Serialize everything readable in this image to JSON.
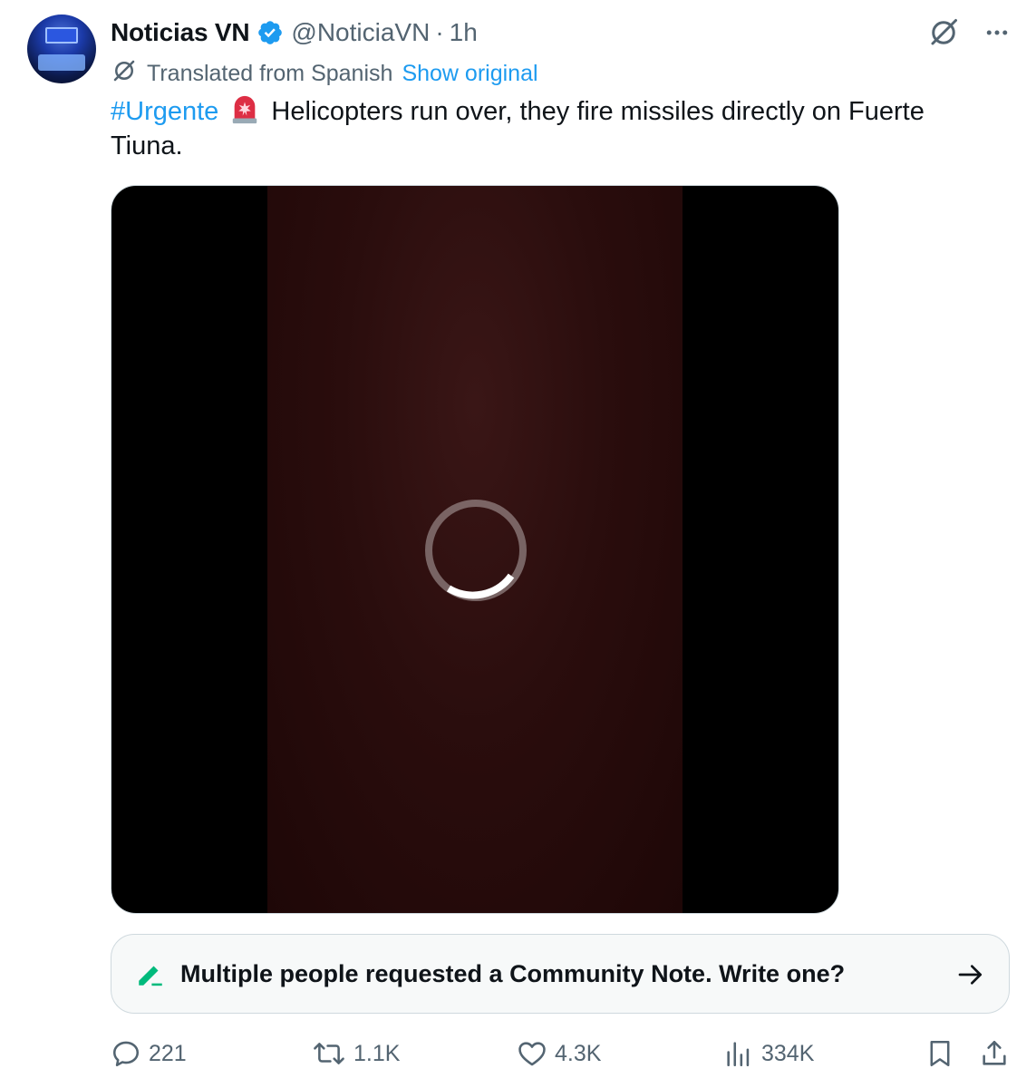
{
  "author": {
    "display_name": "Noticias VN",
    "handle": "@NoticiaVN",
    "separator": "·",
    "time": "1h",
    "verified": true
  },
  "translation": {
    "label": "Translated from Spanish",
    "show_original": "Show original"
  },
  "tweet": {
    "hashtag": "#Urgente",
    "emoji": "police-light-emoji",
    "text": " Helicopters run over, they fire missiles directly on Fuerte Tiuna."
  },
  "media": {
    "type": "video",
    "state": "loading"
  },
  "community_note": {
    "text": "Multiple people requested a Community Note. Write one?"
  },
  "actions": {
    "replies": "221",
    "reposts": "1.1K",
    "likes": "4.3K",
    "views": "334K"
  },
  "colors": {
    "accent": "#1d9bf0",
    "secondary_text": "#536471",
    "note_green": "#00ba7c"
  }
}
